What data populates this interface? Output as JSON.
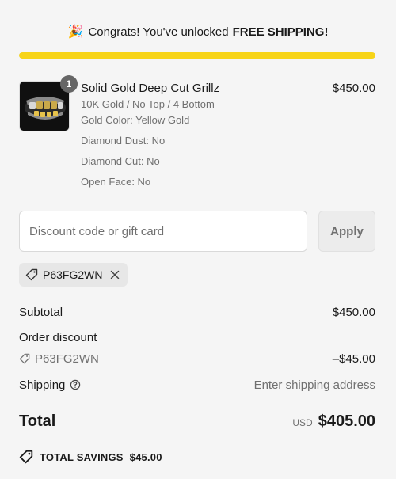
{
  "banner": {
    "emoji": "🎉",
    "text": "Congrats! You've unlocked",
    "highlight": "FREE SHIPPING!",
    "progress_fraction": 1.0,
    "progress_color": "#f7d417"
  },
  "cart_item": {
    "quantity": "1",
    "name": "Solid Gold Deep Cut Grillz",
    "variant": "10K Gold / No Top / 4 Bottom",
    "gold_color": "Gold Color: Yellow Gold",
    "diamond_dust": "Diamond Dust: No",
    "diamond_cut": "Diamond Cut: No",
    "open_face": "Open Face: No",
    "price": "$450.00"
  },
  "discount": {
    "placeholder": "Discount code or gift card",
    "apply_label": "Apply",
    "applied_code": "P63FG2WN"
  },
  "summary": {
    "subtotal_label": "Subtotal",
    "subtotal_value": "$450.00",
    "order_discount_label": "Order discount",
    "discount_code": "P63FG2WN",
    "discount_value": "–$45.00",
    "shipping_label": "Shipping",
    "shipping_value": "Enter shipping address",
    "total_label": "Total",
    "currency": "USD",
    "total_value": "$405.00"
  },
  "savings": {
    "label": "TOTAL SAVINGS",
    "value": "$45.00"
  }
}
